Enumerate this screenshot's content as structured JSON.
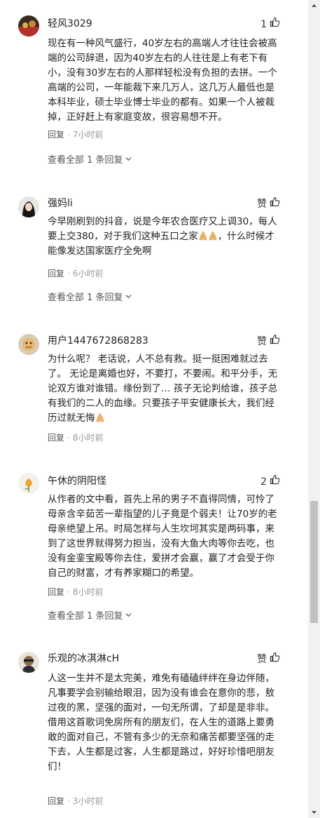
{
  "comments": [
    {
      "username": "轻风3029",
      "likes": "1",
      "text": "现在有一种风气盛行，40岁左右的高端人才往往会被高端的公司辞退，因为40岁左右的人往往是上有老下有小，没有30岁左右的人那样轻松没有负担的去拼。一个高端的公司，一年能裁下来几万人，这几万人最低也是本科毕业，硕士毕业博士毕业的都有。如果一个人被裁掉，正好赶上有家庭变故，很容易想不开。",
      "reply_label": "回复",
      "time": "7小时前",
      "expand": "查看全部 1 条回复"
    },
    {
      "username": "强妈li",
      "likes": "赞",
      "text_before_emoji": "今早刚刷到的抖音，说是今年农合医疗又上调30，每人要上交380，对于我们这种五口之家",
      "text_after_emoji": "，什么时候才能像发达国家医疗全免啊",
      "reply_label": "回复",
      "time": "6小时前",
      "expand": "查看全部 1 条回复"
    },
    {
      "username": "用户1447672868283",
      "likes": "赞",
      "text_before_emoji": "为什么呢？ 老话说，人不总有救。挺一挺困难就过去了。 无论是离婚也好，不要打，不要闹。和平分手，无论双方谁对谁错。缘份到了… 孩子无论判给谁，孩子总有我们的二人的血缘。只要孩子平安健康长大，我们经历过就无悔",
      "text_after_emoji": "",
      "reply_label": "回复",
      "time": "8小时前"
    },
    {
      "username": "午休的阴阳怪",
      "likes": "2",
      "text": "从作者的文中看，首先上吊的男子不直得同情，可怜了母亲含辛茹苦一辈指望的儿子竟是个弱夫！让70岁的老母亲绝望上吊。时局怎样与人生坎坷其实是两码事，来到了这世界就得努力担当，没有大鱼大肉等你去吃，也没有金銮宝殿等你去住，爱拼才会赢，赢了才会受于你自己的财富，才有养家糊口的希望。",
      "reply_label": "回复",
      "time": "8小时前",
      "expand": "查看全部 1 条回复"
    },
    {
      "username": "乐观的冰淇淋cH",
      "likes": "赞",
      "text": "人这一生并不是太完美，难免有磕磕绊绊在身边伴随，凡事要学会别输给眼泪，因为没有谁会在意你的悲，敖过夜的黑，坚强的面对，一句无所谓，了却是是非非。借用这首歌词免房所有的朋友们，在人生的道路上要勇敢的面对自己，不管有多少的无奈和痛苦都要坚强的走下去，人生都是过客，人生都是路过，好好珍惜吧朋友们！",
      "reply_label": "回复",
      "time": "3小时前"
    }
  ],
  "icons": {
    "like": "thumbs-up-icon",
    "expand": "chevron-down-icon",
    "emoji_pray": "pray-emoji",
    "scroll_up": "scroll-up-arrow",
    "scroll_down": "scroll-down-arrow"
  },
  "colors": {
    "text": "#222222",
    "meta": "#999999",
    "link": "#555555",
    "scroll_track": "#f1f1f1",
    "scroll_thumb": "#c1c1c1"
  }
}
